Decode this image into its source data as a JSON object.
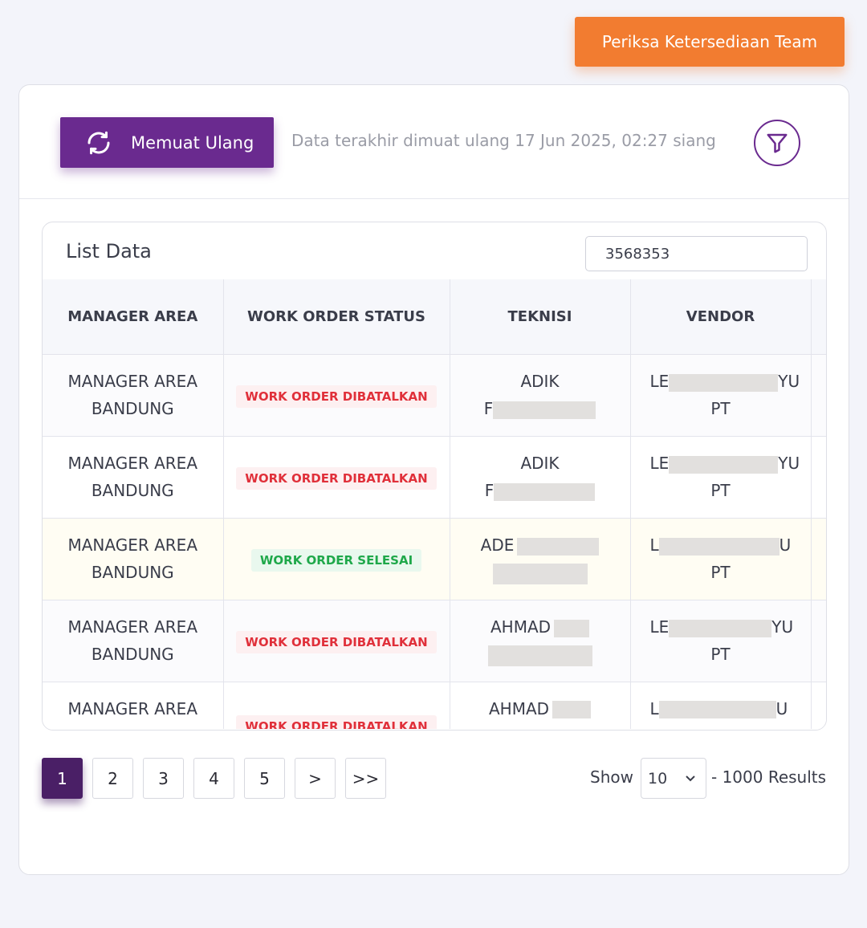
{
  "top_button": "Periksa Ketersediaan Team",
  "reload_button": "Memuat Ulang",
  "last_update": "Data terakhir dimuat ulang 17 Jun 2025, 02:27 siang",
  "list_title": "List Data",
  "search_value": "3568353",
  "columns": [
    "MANAGER AREA",
    "WORK ORDER STATUS",
    "TEKNISI",
    "VENDOR"
  ],
  "rows": [
    {
      "area_1": "MANAGER AREA",
      "area_2": "BANDUNG",
      "status": "WORK ORDER DIBATALKAN",
      "tech_1": "ADIK",
      "tech_2": "F",
      "vendor_1a": "LE",
      "vendor_1b": "YU",
      "vendor_2": "PT"
    },
    {
      "area_1": "MANAGER AREA",
      "area_2": "BANDUNG",
      "status": "WORK ORDER DIBATALKAN",
      "tech_1": "ADIK",
      "tech_2": "F",
      "vendor_1a": "LE",
      "vendor_1b": "YU",
      "vendor_2": "PT"
    },
    {
      "area_1": "MANAGER AREA",
      "area_2": "BANDUNG",
      "status": "WORK ORDER SELESAI",
      "tech_1": "ADE",
      "tech_2": "",
      "vendor_1a": "L",
      "vendor_1b": "U",
      "vendor_2": "PT"
    },
    {
      "area_1": "MANAGER AREA",
      "area_2": "BANDUNG",
      "status": "WORK ORDER DIBATALKAN",
      "tech_1": "AHMAD",
      "tech_2": "",
      "vendor_1a": "LE",
      "vendor_1b": "YU",
      "vendor_2": "PT"
    },
    {
      "area_1": "MANAGER AREA",
      "area_2": "",
      "status": "WORK ORDER DIBATALKAN",
      "tech_1": "AHMAD",
      "tech_2": "",
      "vendor_1a": "L",
      "vendor_1b": "U",
      "vendor_2": ""
    }
  ],
  "pagination": {
    "pages": [
      "1",
      "2",
      "3",
      "4",
      "5"
    ],
    "next": ">",
    "last": ">>",
    "current": "1"
  },
  "show_label": "Show",
  "page_size": "10",
  "results": "- 1000 Results",
  "colors": {
    "accent_orange": "#f27c30",
    "primary_purple": "#6a2a8f",
    "active_page": "#4a1f66",
    "cancel_red": "#e0303a",
    "done_green": "#1fa84a"
  }
}
